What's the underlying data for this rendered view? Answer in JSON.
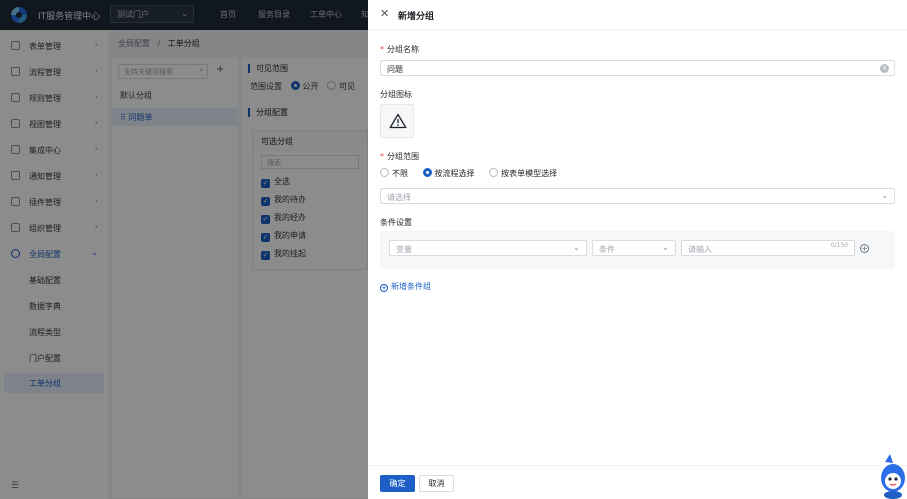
{
  "header": {
    "app_title": "IT服务管理中心",
    "portal_select": "测试门户",
    "nav": [
      "首页",
      "服务目录",
      "工单中心",
      "知"
    ]
  },
  "sidebar": {
    "items": [
      {
        "label": "表单管理"
      },
      {
        "label": "流程管理"
      },
      {
        "label": "规则管理"
      },
      {
        "label": "视图管理"
      },
      {
        "label": "集成中心"
      },
      {
        "label": "通知管理"
      },
      {
        "label": "插件管理"
      },
      {
        "label": "组织管理"
      },
      {
        "label": "全局配置"
      }
    ],
    "sub_items": [
      {
        "label": "基础配置"
      },
      {
        "label": "数据字典"
      },
      {
        "label": "流程类型"
      },
      {
        "label": "门户配置"
      },
      {
        "label": "工单分组"
      }
    ]
  },
  "breadcrumb": {
    "parent": "全局配置",
    "separator": "/",
    "current": "工单分组"
  },
  "groups": {
    "search_placeholder": "支持关键词搜索",
    "items": [
      {
        "label": "默认分组"
      },
      {
        "label": "问题单"
      }
    ]
  },
  "config": {
    "visible_title": "可见范围",
    "scope_label": "范围设置",
    "scope_options": [
      "公开",
      "可见"
    ],
    "group_config_title": "分组配置",
    "optional_title": "可选分组",
    "search_placeholder": "搜索",
    "checks": [
      "全选",
      "我的待办",
      "我的经办",
      "我的申请",
      "我的挂起"
    ]
  },
  "drawer": {
    "title": "新增分组",
    "name_label": "分组名称",
    "name_value": "问题",
    "icon_label": "分组图标",
    "scope_label": "分组范围",
    "scope_options": [
      "不限",
      "按流程选择",
      "按表单模型选择"
    ],
    "scope_selected": "按流程选择",
    "select_placeholder": "请选择",
    "condition_label": "条件设置",
    "cond_var_placeholder": "变量",
    "cond_op_placeholder": "条件",
    "cond_value_placeholder": "请输入",
    "cond_count": "0/150",
    "add_condition": "新增条件组",
    "confirm": "确定",
    "cancel": "取消"
  },
  "colors": {
    "accent": "#1d5fc4",
    "topbar": "#1f2a37",
    "required": "#e8453c"
  }
}
